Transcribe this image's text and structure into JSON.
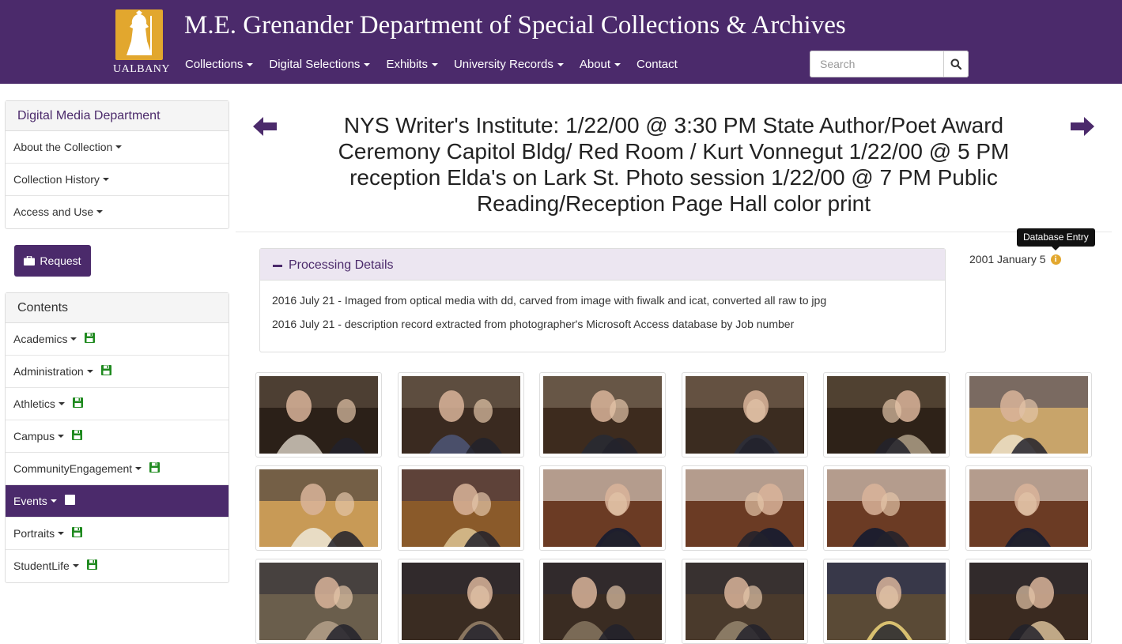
{
  "header": {
    "logo_text": "UALBANY",
    "title": "M.E. Grenander Department of Special Collections & Archives",
    "nav": [
      {
        "label": "Collections",
        "dropdown": true
      },
      {
        "label": "Digital Selections",
        "dropdown": true
      },
      {
        "label": "Exhibits",
        "dropdown": true
      },
      {
        "label": "University Records",
        "dropdown": true
      },
      {
        "label": "About",
        "dropdown": true
      },
      {
        "label": "Contact",
        "dropdown": false
      }
    ],
    "search_placeholder": "Search",
    "search_icon": "search-icon"
  },
  "sidebar": {
    "collection_panel": {
      "title": "Digital Media Department",
      "items": [
        "About the Collection",
        "Collection History",
        "Access and Use"
      ]
    },
    "request_label": "Request",
    "contents_panel": {
      "title": "Contents",
      "items": [
        {
          "label": "Academics",
          "active": false
        },
        {
          "label": "Administration",
          "active": false
        },
        {
          "label": "Athletics",
          "active": false
        },
        {
          "label": "Campus",
          "active": false
        },
        {
          "label": "CommunityEngagement",
          "active": false
        },
        {
          "label": "Events",
          "active": true
        },
        {
          "label": "Portraits",
          "active": false
        },
        {
          "label": "StudentLife",
          "active": false
        }
      ]
    }
  },
  "main": {
    "title": "NYS Writer's Institute: 1/22/00 @ 3:30 PM State Author/Poet Award Ceremony Capitol Bldg/ Red Room / Kurt Vonnegut 1/22/00 @ 5 PM reception Elda's on Lark St. Photo session 1/22/00 @ 7 PM Public Reading/Reception Page Hall color print",
    "processing": {
      "heading": "Processing Details",
      "lines": [
        "2016 July 21 - Imaged from optical media with dd, carved from image with fiwalk and icat, converted all raw to jpg",
        "2016 July 21 - description record extracted from photographer's Microsoft Access database by Job number"
      ]
    },
    "date": "2001 January 5",
    "tooltip": "Database Entry"
  },
  "colors": {
    "brand_purple": "#4b2a6b",
    "gold": "#e2a72e",
    "floppy_green": "#1f8a1f"
  },
  "thumbnails": {
    "rows": 3,
    "columns": 6
  }
}
